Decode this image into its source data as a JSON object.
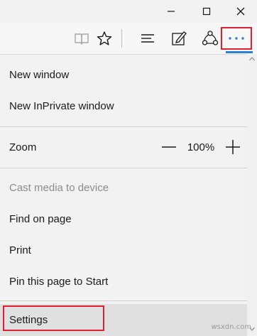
{
  "window_controls": [
    "minimize",
    "maximize",
    "close"
  ],
  "toolbar": {
    "icons": [
      "reading-view-icon",
      "favorites-star-icon",
      "hub-icon",
      "web-note-icon",
      "share-icon",
      "more-actions-icon"
    ]
  },
  "menu": {
    "new_window": "New window",
    "new_inprivate": "New InPrivate window",
    "zoom_label": "Zoom",
    "zoom_value": "100%",
    "cast": "Cast media to device",
    "find": "Find on page",
    "print": "Print",
    "pin": "Pin this page to Start",
    "settings": "Settings"
  },
  "watermark": "wsxdn.com",
  "colors": {
    "highlight_box": "#e02030",
    "accent": "#2b7fd4"
  }
}
